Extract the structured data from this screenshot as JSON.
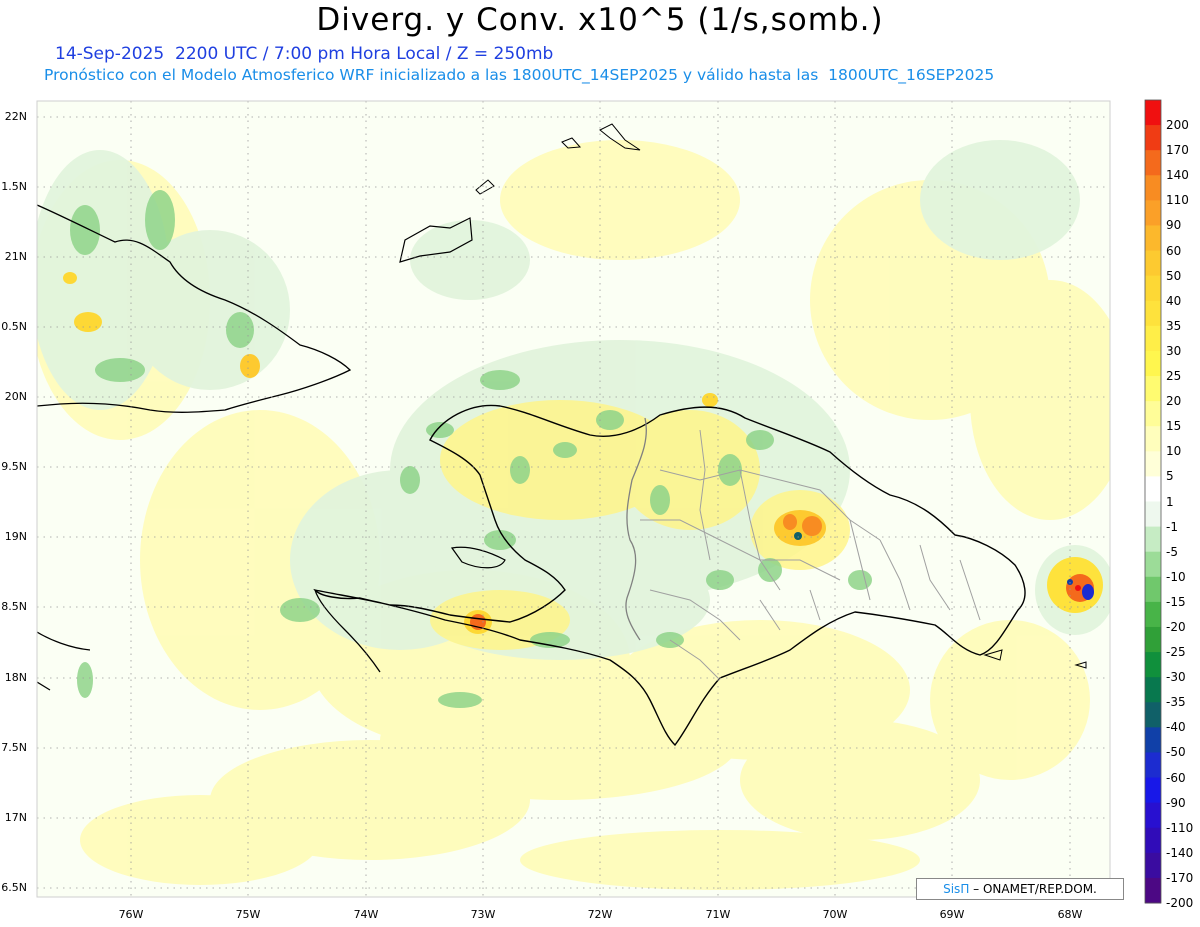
{
  "title": "Diverg. y Conv. x10^5 (1/s,somb.)",
  "subtitle_line1": "14-Sep-2025  2200 UTC / 7:00 pm Hora Local / Z = 250mb",
  "subtitle_line2": "Pronóstico con el Modelo Atmosferico WRF inicializado a las 1800UTC_14SEP2025 y válido hasta las  1800UTC_16SEP2025",
  "lat_labels": [
    "22N",
    "1.5N",
    "21N",
    "0.5N",
    "20N",
    "9.5N",
    "19N",
    "8.5N",
    "18N",
    "7.5N",
    "17N",
    "6.5N"
  ],
  "lon_labels": [
    "76W",
    "75W",
    "74W",
    "73W",
    "72W",
    "71W",
    "70W",
    "69W",
    "68W"
  ],
  "colorbar": {
    "labels": [
      "200",
      "170",
      "140",
      "110",
      "90",
      "60",
      "50",
      "40",
      "35",
      "30",
      "25",
      "20",
      "15",
      "10",
      "5",
      "1",
      "-1",
      "-5",
      "-10",
      "-15",
      "-20",
      "-25",
      "-30",
      "-35",
      "-40",
      "-50",
      "-60",
      "-90",
      "-110",
      "-140",
      "-170",
      "-200"
    ],
    "colors": [
      "#f01010",
      "#f03c14",
      "#f46a1c",
      "#f88c22",
      "#fba028",
      "#fcb82c",
      "#fdca30",
      "#fdd835",
      "#fee23c",
      "#ffee48",
      "#fff64e",
      "#fffb70",
      "#fffd98",
      "#fffebc",
      "#ffffd8",
      "#ffffff",
      "#eef8ee",
      "#c6ecc4",
      "#9cdc98",
      "#70c86c",
      "#48b448",
      "#30a038",
      "#10903c",
      "#08784e",
      "#106068",
      "#1040a8",
      "#1c2cd0",
      "#1818e8",
      "#2810d0",
      "#300cb8",
      "#3a0ca0",
      "#4c0884"
    ]
  },
  "credit_sis": "SisΠ",
  "credit_rest": " – ONAMET/REP.DOM.",
  "colors": {
    "sea_background": "#ffffff",
    "coastline": "#000000",
    "province_borders": "#a0a0a0",
    "grid": "#999999"
  }
}
